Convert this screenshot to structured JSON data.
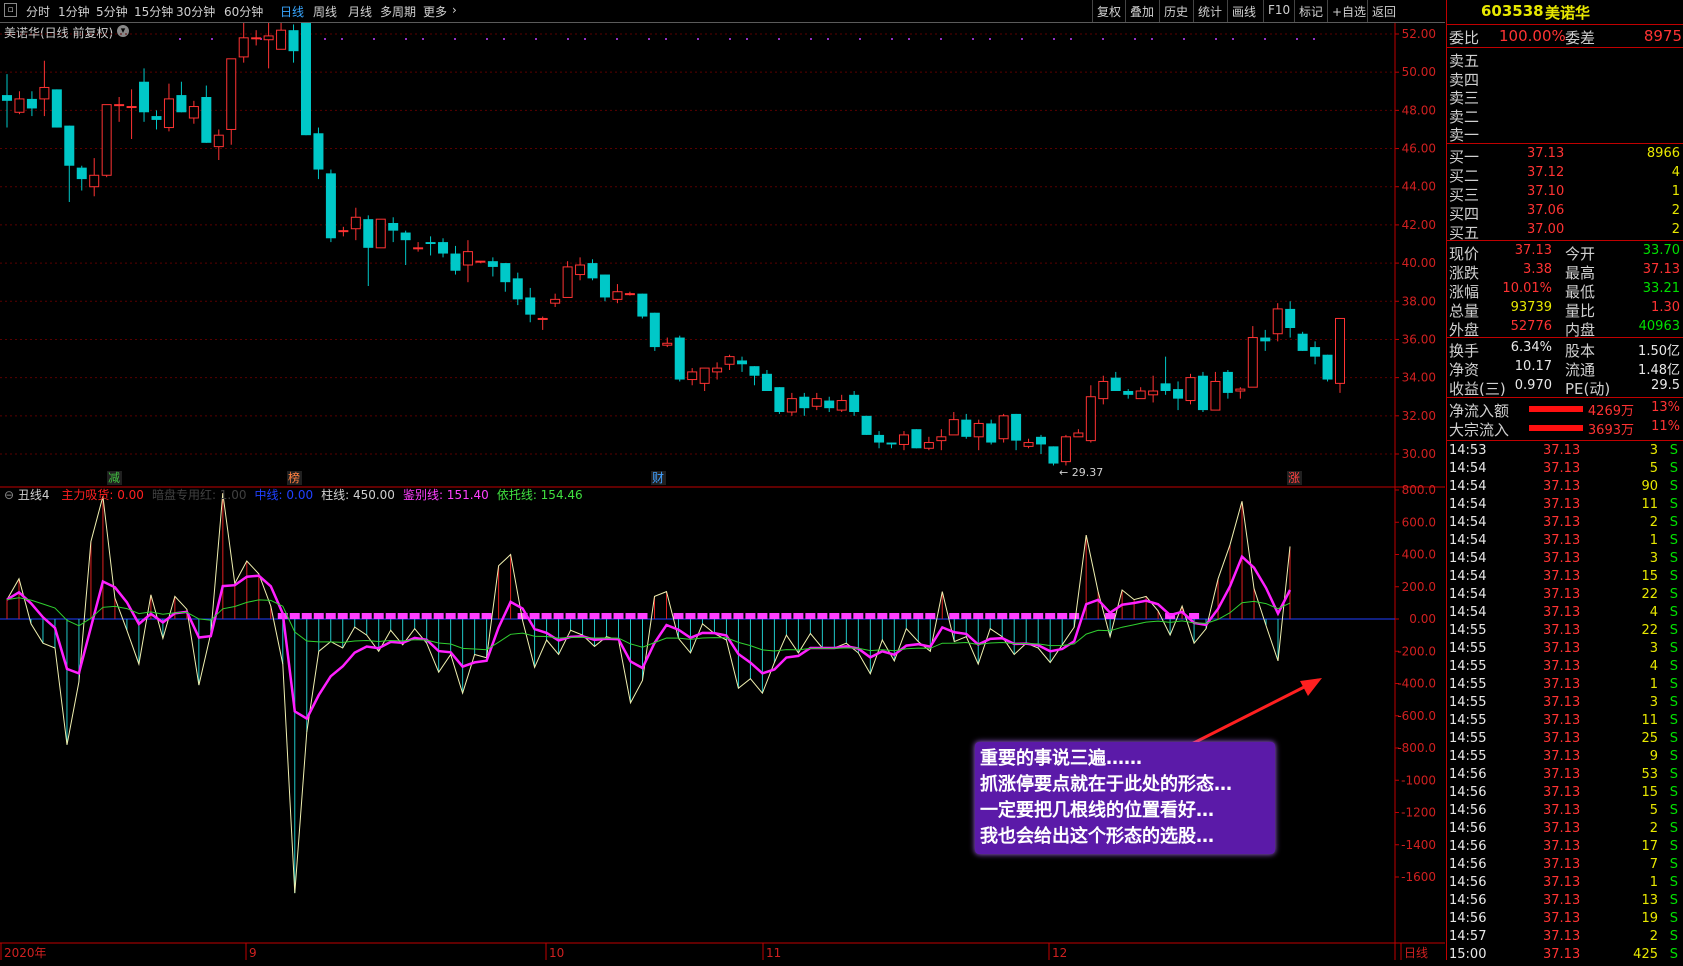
{
  "toolbar": {
    "periods": [
      "分时",
      "1分钟",
      "5分钟",
      "15分钟",
      "30分钟",
      "60分钟",
      "日线",
      "周线",
      "月线",
      "多周期",
      "更多"
    ],
    "active_period": "日线",
    "actions": [
      "复权",
      "叠加",
      "历史",
      "统计",
      "画线",
      "F10",
      "标记",
      "+自选",
      "返回"
    ]
  },
  "chart_title": "美诺华(日线 前复权)",
  "price_axis": [
    "52.00",
    "50.00",
    "48.00",
    "46.00",
    "44.00",
    "42.00",
    "40.00",
    "38.00",
    "36.00",
    "34.00",
    "32.00",
    "30.00"
  ],
  "annotations": {
    "high": "52.80",
    "low": "29.37"
  },
  "event_tags": [
    "减",
    "榜",
    "财",
    "涨"
  ],
  "indicator": {
    "name": "丑线4",
    "legend": [
      {
        "text": "主力吸货: 0.00",
        "color": "#ff2020"
      },
      {
        "text": "暗盘专用红: 1.00",
        "color": "#404040"
      },
      {
        "text": "中线: 0.00",
        "color": "#2040ff"
      },
      {
        "text": "柱线: 450.00",
        "color": "#d0d0d0"
      },
      {
        "text": "鉴别线: 151.40",
        "color": "#ff40ff"
      },
      {
        "text": "依托线: 154.46",
        "color": "#40e040"
      }
    ],
    "axis": [
      "800.0",
      "600.0",
      "400.0",
      "200.0",
      "0.00",
      "-200.0",
      "-400.0",
      "-600.0",
      "-800.0",
      "-1000",
      "-1200",
      "-1400",
      "-1600"
    ]
  },
  "x_axis": [
    "2020年",
    "9",
    "10",
    "11",
    "12",
    "日线"
  ],
  "note_lines": [
    "重要的事说三遍……",
    "抓涨停要点就在于此处的形态…",
    "一定要把几根线的位置看好…",
    "我也会给出这个形态的选股…"
  ],
  "quote": {
    "code": "603538",
    "name": "美诺华",
    "weibi_label": "委比",
    "weibi": "100.00%",
    "weicha_label": "委差",
    "weicha": "8975",
    "sells": [
      "卖五",
      "卖四",
      "卖三",
      "卖二",
      "卖一"
    ],
    "buys": [
      {
        "label": "买一",
        "price": "37.13",
        "vol": "8966"
      },
      {
        "label": "买二",
        "price": "37.12",
        "vol": "4"
      },
      {
        "label": "买三",
        "price": "37.10",
        "vol": "1"
      },
      {
        "label": "买四",
        "price": "37.06",
        "vol": "2"
      },
      {
        "label": "买五",
        "price": "37.00",
        "vol": "2"
      }
    ],
    "stats": [
      {
        "l1": "现价",
        "v1": "37.13",
        "c1": "#ff3333",
        "l2": "今开",
        "v2": "33.70",
        "c2": "#00e000"
      },
      {
        "l1": "涨跌",
        "v1": "3.38",
        "c1": "#ff3333",
        "l2": "最高",
        "v2": "37.13",
        "c2": "#ff3333"
      },
      {
        "l1": "涨幅",
        "v1": "10.01%",
        "c1": "#ff3333",
        "l2": "最低",
        "v2": "33.21",
        "c2": "#00e000"
      },
      {
        "l1": "总量",
        "v1": "93739",
        "c1": "#e8e800",
        "l2": "量比",
        "v2": "1.30",
        "c2": "#ff3333"
      },
      {
        "l1": "外盘",
        "v1": "52776",
        "c1": "#ff3333",
        "l2": "内盘",
        "v2": "40963",
        "c2": "#00e000"
      }
    ],
    "stats2": [
      {
        "l1": "换手",
        "v1": "6.34%",
        "l2": "股本",
        "v2": "1.50亿"
      },
      {
        "l1": "净资",
        "v1": "10.17",
        "l2": "流通",
        "v2": "1.48亿"
      },
      {
        "l1": "收益(三)",
        "v1": "0.970",
        "l2": "PE(动)",
        "v2": "29.5"
      }
    ],
    "flows": [
      {
        "label": "净流入额",
        "value": "4269万",
        "pct": "13%"
      },
      {
        "label": "大宗流入",
        "value": "3693万",
        "pct": "11%"
      }
    ]
  },
  "ticks": [
    [
      "14:53",
      "37.13",
      "3",
      "S"
    ],
    [
      "14:54",
      "37.13",
      "5",
      "S"
    ],
    [
      "14:54",
      "37.13",
      "90",
      "S"
    ],
    [
      "14:54",
      "37.13",
      "11",
      "S"
    ],
    [
      "14:54",
      "37.13",
      "2",
      "S"
    ],
    [
      "14:54",
      "37.13",
      "1",
      "S"
    ],
    [
      "14:54",
      "37.13",
      "3",
      "S"
    ],
    [
      "14:54",
      "37.13",
      "15",
      "S"
    ],
    [
      "14:54",
      "37.13",
      "22",
      "S"
    ],
    [
      "14:54",
      "37.13",
      "4",
      "S"
    ],
    [
      "14:55",
      "37.13",
      "22",
      "S"
    ],
    [
      "14:55",
      "37.13",
      "3",
      "S"
    ],
    [
      "14:55",
      "37.13",
      "4",
      "S"
    ],
    [
      "14:55",
      "37.13",
      "1",
      "S"
    ],
    [
      "14:55",
      "37.13",
      "3",
      "S"
    ],
    [
      "14:55",
      "37.13",
      "11",
      "S"
    ],
    [
      "14:55",
      "37.13",
      "25",
      "S"
    ],
    [
      "14:55",
      "37.13",
      "9",
      "S"
    ],
    [
      "14:56",
      "37.13",
      "53",
      "S"
    ],
    [
      "14:56",
      "37.13",
      "15",
      "S"
    ],
    [
      "14:56",
      "37.13",
      "5",
      "S"
    ],
    [
      "14:56",
      "37.13",
      "2",
      "S"
    ],
    [
      "14:56",
      "37.13",
      "17",
      "S"
    ],
    [
      "14:56",
      "37.13",
      "7",
      "S"
    ],
    [
      "14:56",
      "37.13",
      "1",
      "S"
    ],
    [
      "14:56",
      "37.13",
      "13",
      "S"
    ],
    [
      "14:56",
      "37.13",
      "19",
      "S"
    ],
    [
      "14:57",
      "37.13",
      "2",
      "S"
    ],
    [
      "15:00",
      "37.13",
      "425",
      "S"
    ]
  ],
  "candles": [
    [
      48.8,
      48.5,
      49.9,
      47.1
    ],
    [
      47.9,
      48.6,
      49.0,
      47.8
    ],
    [
      48.6,
      48.1,
      49.0,
      47.7
    ],
    [
      48.6,
      49.2,
      50.6,
      47.7
    ],
    [
      49.1,
      47.1,
      49.1,
      47.1
    ],
    [
      47.2,
      45.1,
      47.2,
      43.2
    ],
    [
      45.0,
      44.4,
      45.1,
      43.8
    ],
    [
      44.0,
      44.6,
      45.5,
      43.5
    ],
    [
      44.6,
      48.3,
      48.3,
      44.5
    ],
    [
      48.3,
      48.3,
      48.7,
      47.4
    ],
    [
      48.2,
      48.2,
      49.1,
      46.5
    ],
    [
      49.5,
      47.9,
      50.2,
      47.4
    ],
    [
      47.7,
      47.5,
      48.0,
      47.0
    ],
    [
      47.1,
      48.6,
      49.4,
      46.9
    ],
    [
      48.8,
      47.9,
      49.5,
      47.9
    ],
    [
      47.6,
      48.2,
      48.5,
      47.3
    ],
    [
      48.7,
      46.3,
      49.3,
      46.3
    ],
    [
      46.1,
      46.7,
      47.0,
      45.4
    ],
    [
      47.0,
      50.7,
      50.7,
      46.2
    ],
    [
      50.8,
      51.8,
      52.8,
      50.5
    ],
    [
      51.8,
      51.8,
      52.2,
      51.4
    ],
    [
      51.7,
      51.9,
      52.8,
      50.2
    ],
    [
      51.2,
      52.2,
      52.6,
      51.6
    ],
    [
      52.2,
      51.1,
      52.5,
      50.5
    ],
    [
      52.6,
      46.7,
      52.6,
      46.7
    ],
    [
      46.8,
      44.9,
      47.1,
      44.4
    ],
    [
      44.7,
      41.3,
      44.9,
      41.1
    ],
    [
      41.7,
      41.7,
      41.9,
      41.4
    ],
    [
      41.8,
      42.4,
      42.9,
      41.2
    ],
    [
      42.3,
      40.8,
      42.5,
      38.8
    ],
    [
      40.8,
      42.3,
      42.3,
      40.8
    ],
    [
      42.1,
      41.7,
      42.4,
      41.1
    ],
    [
      41.6,
      41.2,
      41.7,
      39.9
    ],
    [
      40.8,
      40.8,
      41.1,
      40.6
    ],
    [
      41.1,
      41.0,
      41.4,
      40.4
    ],
    [
      41.1,
      40.5,
      41.3,
      40.3
    ],
    [
      40.5,
      39.6,
      40.9,
      39.4
    ],
    [
      39.9,
      40.6,
      41.2,
      39.0
    ],
    [
      40.1,
      40.1,
      40.1,
      40.0
    ],
    [
      40.1,
      39.8,
      40.3,
      39.3
    ],
    [
      40.0,
      39.0,
      40.0,
      38.5
    ],
    [
      39.2,
      38.1,
      39.5,
      37.8
    ],
    [
      38.2,
      37.3,
      38.7,
      36.9
    ],
    [
      37.1,
      37.1,
      37.2,
      36.5
    ],
    [
      37.9,
      38.1,
      38.4,
      37.7
    ],
    [
      38.2,
      39.8,
      40.1,
      38.2
    ],
    [
      39.4,
      39.9,
      40.3,
      39.1
    ],
    [
      40.0,
      39.2,
      40.2,
      39.1
    ],
    [
      39.4,
      38.2,
      39.4,
      38.0
    ],
    [
      38.1,
      38.5,
      38.9,
      37.9
    ],
    [
      38.4,
      38.4,
      38.5,
      38.3
    ],
    [
      38.4,
      37.2,
      38.4,
      37.1
    ],
    [
      37.4,
      35.6,
      37.4,
      35.4
    ],
    [
      35.7,
      35.8,
      36.1,
      35.6
    ],
    [
      36.1,
      33.9,
      36.2,
      33.8
    ],
    [
      33.9,
      34.3,
      34.5,
      33.6
    ],
    [
      33.7,
      34.5,
      34.5,
      33.3
    ],
    [
      34.3,
      34.5,
      34.8,
      33.9
    ],
    [
      34.7,
      35.1,
      35.2,
      34.4
    ],
    [
      34.9,
      34.7,
      35.1,
      34.3
    ],
    [
      34.6,
      34.1,
      34.6,
      33.6
    ],
    [
      34.2,
      33.3,
      34.4,
      33.3
    ],
    [
      33.5,
      32.2,
      33.5,
      32.1
    ],
    [
      32.2,
      32.9,
      33.2,
      32.0
    ],
    [
      33.0,
      32.4,
      33.2,
      32.0
    ],
    [
      32.5,
      32.9,
      33.2,
      32.3
    ],
    [
      32.8,
      32.4,
      33.0,
      32.2
    ],
    [
      32.3,
      32.8,
      33.1,
      32.2
    ],
    [
      33.1,
      32.2,
      33.3,
      32.0
    ],
    [
      32.0,
      31.0,
      32.0,
      31.0
    ],
    [
      31.0,
      30.6,
      31.2,
      30.3
    ],
    [
      30.6,
      30.5,
      30.6,
      30.3
    ],
    [
      30.5,
      31.0,
      31.2,
      30.2
    ],
    [
      31.3,
      30.3,
      31.3,
      30.3
    ],
    [
      30.3,
      30.6,
      30.9,
      30.2
    ],
    [
      30.7,
      30.9,
      31.3,
      30.2
    ],
    [
      31.0,
      31.8,
      32.2,
      31.0
    ],
    [
      31.8,
      30.9,
      32.1,
      30.8
    ],
    [
      30.9,
      31.6,
      31.8,
      30.2
    ],
    [
      31.6,
      30.6,
      31.8,
      30.5
    ],
    [
      30.8,
      32.0,
      32.1,
      30.6
    ],
    [
      32.1,
      30.7,
      32.1,
      30.2
    ],
    [
      30.4,
      30.6,
      30.8,
      30.3
    ],
    [
      30.9,
      30.5,
      31.0,
      30.0
    ],
    [
      30.4,
      29.5,
      30.4,
      29.4
    ],
    [
      29.6,
      30.9,
      31.0,
      29.4
    ],
    [
      30.9,
      31.1,
      31.3,
      30.9
    ],
    [
      30.7,
      33.0,
      33.6,
      30.6
    ],
    [
      32.9,
      33.8,
      34.1,
      32.6
    ],
    [
      34.0,
      33.3,
      34.3,
      33.3
    ],
    [
      33.3,
      33.1,
      33.4,
      32.9
    ],
    [
      32.9,
      33.3,
      33.5,
      33.1
    ],
    [
      33.1,
      33.3,
      34.1,
      32.7
    ],
    [
      33.7,
      33.3,
      35.1,
      33.1
    ],
    [
      33.4,
      32.9,
      33.8,
      32.3
    ],
    [
      32.8,
      34.0,
      34.2,
      32.6
    ],
    [
      34.1,
      32.3,
      34.3,
      32.2
    ],
    [
      32.3,
      33.8,
      34.3,
      32.3
    ],
    [
      34.3,
      33.2,
      34.4,
      32.9
    ],
    [
      33.3,
      33.4,
      33.5,
      32.9
    ],
    [
      33.5,
      36.1,
      36.7,
      33.5
    ],
    [
      36.1,
      35.9,
      36.5,
      35.4
    ],
    [
      36.3,
      37.6,
      37.9,
      35.9
    ],
    [
      37.6,
      36.6,
      38.0,
      36.1
    ],
    [
      36.3,
      35.4,
      36.4,
      35.4
    ],
    [
      35.6,
      35.1,
      35.9,
      34.7
    ],
    [
      35.2,
      33.9,
      35.2,
      33.8
    ],
    [
      33.7,
      37.1,
      37.1,
      33.2
    ]
  ],
  "osc": [
    120,
    250,
    -30,
    -150,
    -180,
    -780,
    -390,
    480,
    760,
    130,
    -70,
    -280,
    150,
    -120,
    140,
    60,
    -410,
    -90,
    780,
    220,
    360,
    280,
    80,
    -280,
    -1700,
    -700,
    -200,
    -140,
    -180,
    -50,
    -100,
    -200,
    -70,
    -160,
    -60,
    -150,
    -330,
    -220,
    -460,
    -220,
    -240,
    330,
    400,
    -10,
    -300,
    -130,
    -220,
    -70,
    -100,
    -170,
    -110,
    -130,
    -520,
    -380,
    140,
    170,
    -120,
    -210,
    -30,
    -90,
    -130,
    -430,
    -370,
    -460,
    -270,
    -100,
    -210,
    -90,
    -180,
    -180,
    -150,
    -210,
    -340,
    -130,
    -260,
    -60,
    -140,
    -200,
    170,
    -140,
    -110,
    -280,
    -60,
    -110,
    -220,
    -150,
    -180,
    -270,
    -160,
    -50,
    520,
    170,
    -110,
    180,
    120,
    140,
    50,
    -100,
    80,
    -150,
    -60,
    250,
    460,
    730,
    190,
    -40,
    -260,
    450
  ],
  "cyan_gaps": [
    "no data"
  ]
}
